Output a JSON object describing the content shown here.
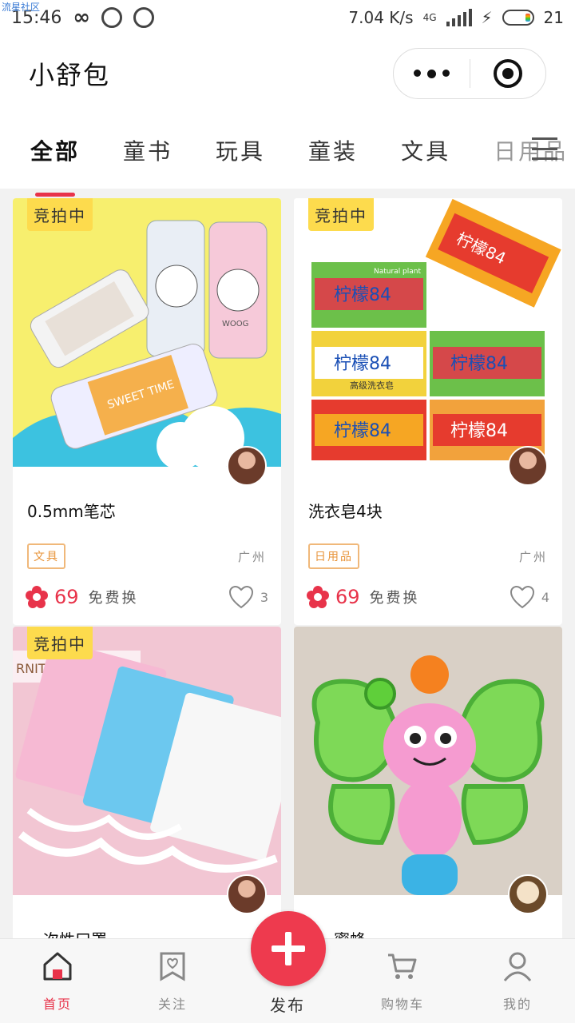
{
  "status_bar": {
    "time": "15:46",
    "carrier_note": "流星社区",
    "net_speed": "7.04 K/s",
    "network": "4G",
    "battery": "21"
  },
  "header": {
    "title": "小舒包"
  },
  "tabs": [
    {
      "label": "全部",
      "active": true
    },
    {
      "label": "童书"
    },
    {
      "label": "玩具"
    },
    {
      "label": "童装"
    },
    {
      "label": "文具"
    },
    {
      "label": "日用品"
    }
  ],
  "products": [
    {
      "badge": "竞拍中",
      "title": "0.5mm笔芯",
      "tag": "文具",
      "location": "广州",
      "price": "69",
      "swap_label": "免费换",
      "likes": "3"
    },
    {
      "badge": "竞拍中",
      "title": "洗衣皂4块",
      "tag": "日用品",
      "location": "广州",
      "price": "69",
      "swap_label": "免费换",
      "likes": "4"
    },
    {
      "badge": "竞拍中",
      "title": "一次性口罩",
      "image_text": "RNITURE 家具"
    },
    {
      "title": "蜜蜂"
    }
  ],
  "product_image_text": {
    "soap_brand": "柠檬84",
    "soap_sub": "高级洗衣皂",
    "soap_tag": "Natural plant",
    "pen_text": "SWEET TIME",
    "pen_brand": "WOOG"
  },
  "bottom_nav": {
    "home": "首页",
    "follow": "关注",
    "publish": "发布",
    "cart": "购物车",
    "mine": "我的"
  },
  "colors": {
    "accent": "#e8334a",
    "badge": "#fddb4d",
    "tag": "#e8943a"
  }
}
